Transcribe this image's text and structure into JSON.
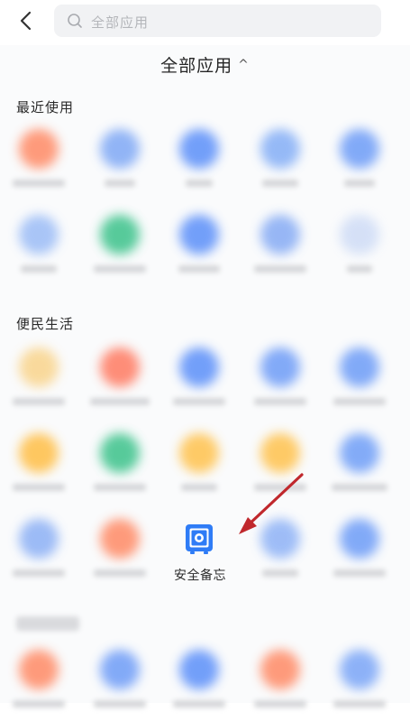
{
  "header": {
    "search_placeholder": "全部应用"
  },
  "panel": {
    "title": "全部应用",
    "caret": "^"
  },
  "sections": [
    {
      "heading": "最近使用"
    },
    {
      "heading": "便民生活"
    }
  ],
  "featured_app": {
    "label": "安全备忘",
    "icon": "safe-icon"
  },
  "colors": {
    "blue": "#5b8ff9",
    "orange": "#ff8a65",
    "green": "#3bc28a",
    "yellow": "#ffc24d",
    "icon_blue": "#2f7cf6",
    "arrow_red": "#c0282d"
  }
}
